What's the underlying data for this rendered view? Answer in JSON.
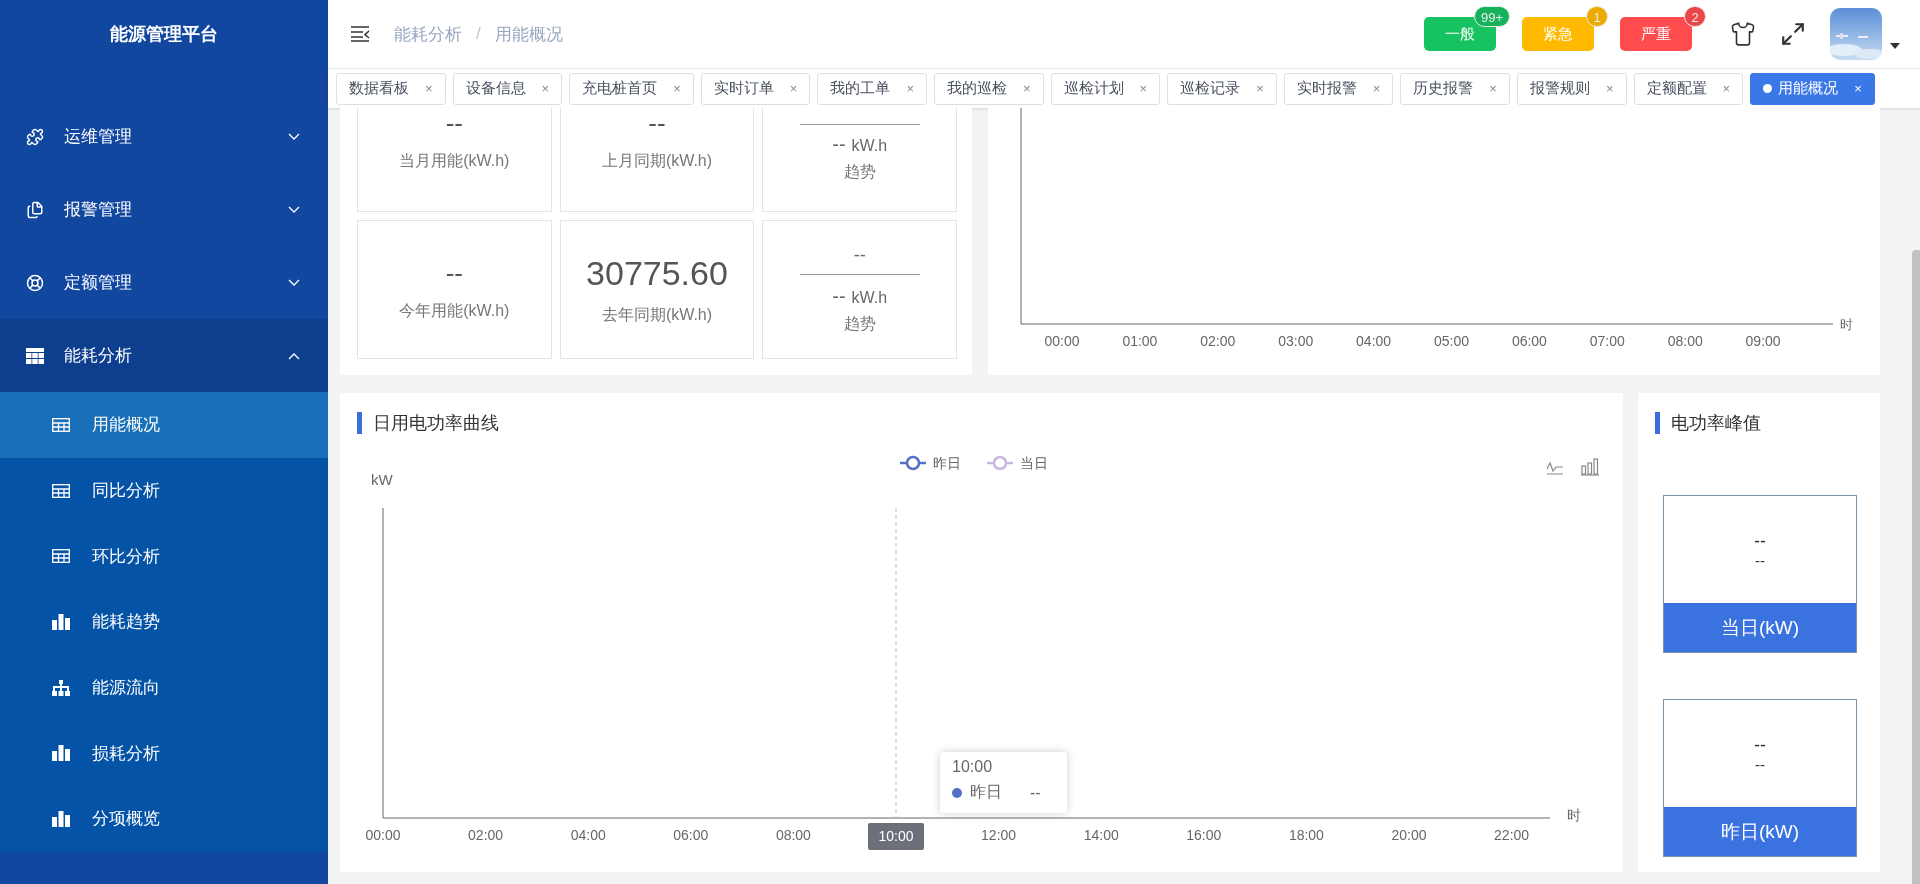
{
  "sidebar": {
    "title": "能源管理平台",
    "menu": [
      {
        "label": "运维管理",
        "expanded": false
      },
      {
        "label": "报警管理",
        "expanded": false
      },
      {
        "label": "定额管理",
        "expanded": false
      },
      {
        "label": "能耗分析",
        "expanded": true,
        "children": [
          {
            "label": "用能概况",
            "selected": true
          },
          {
            "label": "同比分析",
            "selected": false
          },
          {
            "label": "环比分析",
            "selected": false
          },
          {
            "label": "能耗趋势",
            "selected": false
          },
          {
            "label": "能源流向",
            "selected": false
          },
          {
            "label": "损耗分析",
            "selected": false
          },
          {
            "label": "分项概览",
            "selected": false
          }
        ]
      }
    ]
  },
  "header": {
    "breadcrumb": [
      "能耗分析",
      "用能概况"
    ],
    "breadcrumb_separator": "/",
    "alarm_buttons": [
      {
        "label": "一般",
        "count": "99+",
        "color": "#17c261"
      },
      {
        "label": "紧急",
        "count": "1",
        "color": "#ffba00"
      },
      {
        "label": "严重",
        "count": "2",
        "color": "#ff4d4f"
      }
    ]
  },
  "tabs": [
    {
      "label": "数据看板",
      "close": "×",
      "selected": false
    },
    {
      "label": "设备信息",
      "close": "×",
      "selected": false
    },
    {
      "label": "充电桩首页",
      "close": "×",
      "selected": false
    },
    {
      "label": "实时订单",
      "close": "×",
      "selected": false
    },
    {
      "label": "我的工单",
      "close": "×",
      "selected": false
    },
    {
      "label": "我的巡检",
      "close": "×",
      "selected": false
    },
    {
      "label": "巡检计划",
      "close": "×",
      "selected": false
    },
    {
      "label": "巡检记录",
      "close": "×",
      "selected": false
    },
    {
      "label": "实时报警",
      "close": "×",
      "selected": false
    },
    {
      "label": "历史报警",
      "close": "×",
      "selected": false
    },
    {
      "label": "报警规则",
      "close": "×",
      "selected": false
    },
    {
      "label": "定额配置",
      "close": "×",
      "selected": false
    },
    {
      "label": "用能概况",
      "close": "×",
      "selected": true
    }
  ],
  "energy_cards": [
    [
      {
        "kind": "stat",
        "value": "--",
        "label": "当月用能(kW.h)"
      },
      {
        "kind": "stat",
        "value": "--",
        "label": "上月同期(kW.h)"
      },
      {
        "kind": "trend",
        "value": "--",
        "unit": "kW.h",
        "label": "趋势"
      }
    ],
    [
      {
        "kind": "stat",
        "value": "--",
        "label": "今年用能(kW.h)"
      },
      {
        "kind": "stat",
        "value": "30775.60",
        "label": "去年同期(kW.h)"
      },
      {
        "kind": "trend",
        "ratio": "--",
        "value": "--",
        "unit": "kW.h",
        "label": "趋势"
      }
    ]
  ],
  "hourly_chart": {
    "x_labels": [
      "00:00",
      "01:00",
      "02:00",
      "03:00",
      "04:00",
      "05:00",
      "06:00",
      "07:00",
      "08:00",
      "09:00"
    ],
    "x_unit": "时"
  },
  "power_curve": {
    "title": "日用电功率曲线",
    "y_unit": "kW",
    "legend": [
      {
        "label": "昨日",
        "color": "#5470c6"
      },
      {
        "label": "当日",
        "color": "#c9b5e0"
      }
    ],
    "x_labels": [
      {
        "label": "00:00",
        "highlighted": false
      },
      {
        "label": "02:00",
        "highlighted": false
      },
      {
        "label": "04:00",
        "highlighted": false
      },
      {
        "label": "06:00",
        "highlighted": false
      },
      {
        "label": "08:00",
        "highlighted": false
      },
      {
        "label": "10:00",
        "highlighted": true
      },
      {
        "label": "12:00",
        "highlighted": false
      },
      {
        "label": "14:00",
        "highlighted": false
      },
      {
        "label": "16:00",
        "highlighted": false
      },
      {
        "label": "18:00",
        "highlighted": false
      },
      {
        "label": "20:00",
        "highlighted": false
      },
      {
        "label": "22:00",
        "highlighted": false
      }
    ],
    "x_unit": "时",
    "tooltip": {
      "title": "10:00",
      "series": "昨日",
      "value": "--",
      "color": "#5470c6"
    }
  },
  "peak_power": {
    "title": "电功率峰值",
    "cards": [
      {
        "value": "--",
        "time": "--",
        "label": "当日(kW)"
      },
      {
        "value": "--",
        "time": "--",
        "label": "昨日(kW)"
      }
    ]
  }
}
